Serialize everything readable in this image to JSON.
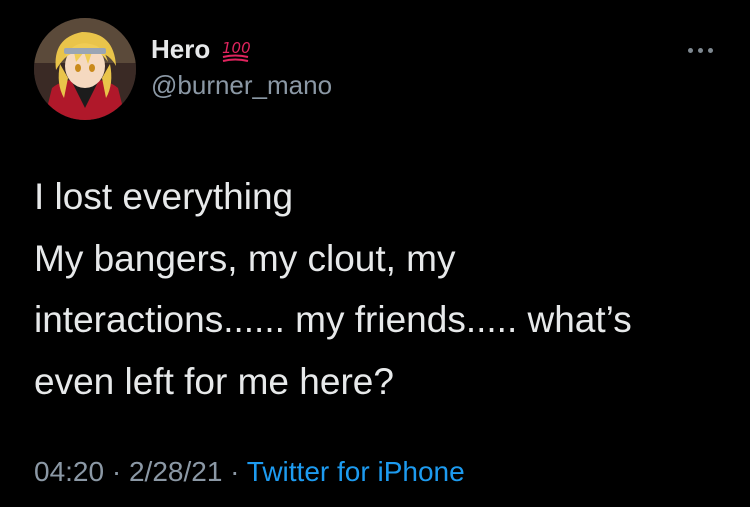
{
  "author": {
    "display_name": "Hero",
    "badge_emoji": "💯",
    "handle": "@burner_mano",
    "avatar_icon": "anime-character-avatar"
  },
  "actions": {
    "more_icon": "more-options-icon"
  },
  "tweet": {
    "lines": [
      "I lost everything",
      "My bangers, my clout, my",
      "interactions...... my friends..... what’s",
      "even left for me here?"
    ]
  },
  "meta": {
    "time": "04:20",
    "separator": "·",
    "date": "2/28/21",
    "source": "Twitter for iPhone"
  },
  "colors": {
    "background": "#000000",
    "text": "#e7e9ea",
    "secondary": "#8b98a5",
    "link": "#1d9bf0",
    "badge": "#e0245e"
  }
}
